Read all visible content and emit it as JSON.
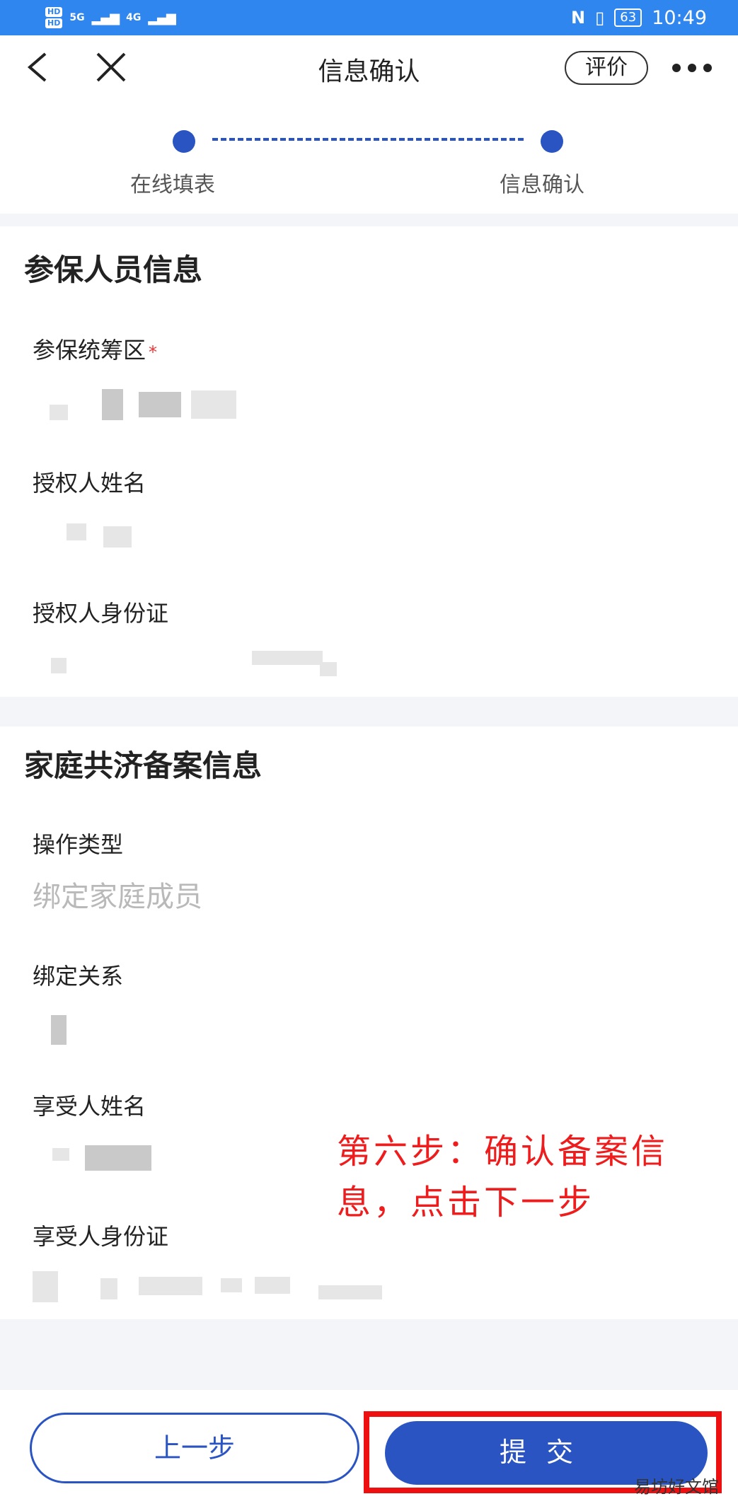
{
  "status_bar": {
    "hd1": "HD",
    "hd2": "HD",
    "net1": "5G",
    "net2": "4G",
    "nfc": "N",
    "battery": "63",
    "time": "10:49"
  },
  "nav": {
    "title": "信息确认",
    "rate_label": "评价"
  },
  "steps": {
    "step1": "在线填表",
    "step2": "信息确认"
  },
  "insured_section": {
    "title": "参保人员信息",
    "fields": [
      {
        "label": "参保统筹区",
        "required_mark": "*"
      },
      {
        "label": "授权人姓名"
      },
      {
        "label": "授权人身份证"
      }
    ]
  },
  "family_section": {
    "title": "家庭共济备案信息",
    "fields": [
      {
        "label": "操作类型",
        "value": "绑定家庭成员"
      },
      {
        "label": "绑定关系"
      },
      {
        "label": "享受人姓名"
      },
      {
        "label": "享受人身份证"
      }
    ]
  },
  "annotation": {
    "text": "第六步：确认备案信息，点击下一步"
  },
  "footer": {
    "prev_label": "上一步",
    "submit_label": "提交"
  },
  "watermark": "易坊好文馆",
  "colors": {
    "status_bar": "#2f86ef",
    "primary": "#2a54c2",
    "annotation_red": "#ee1c1c"
  }
}
